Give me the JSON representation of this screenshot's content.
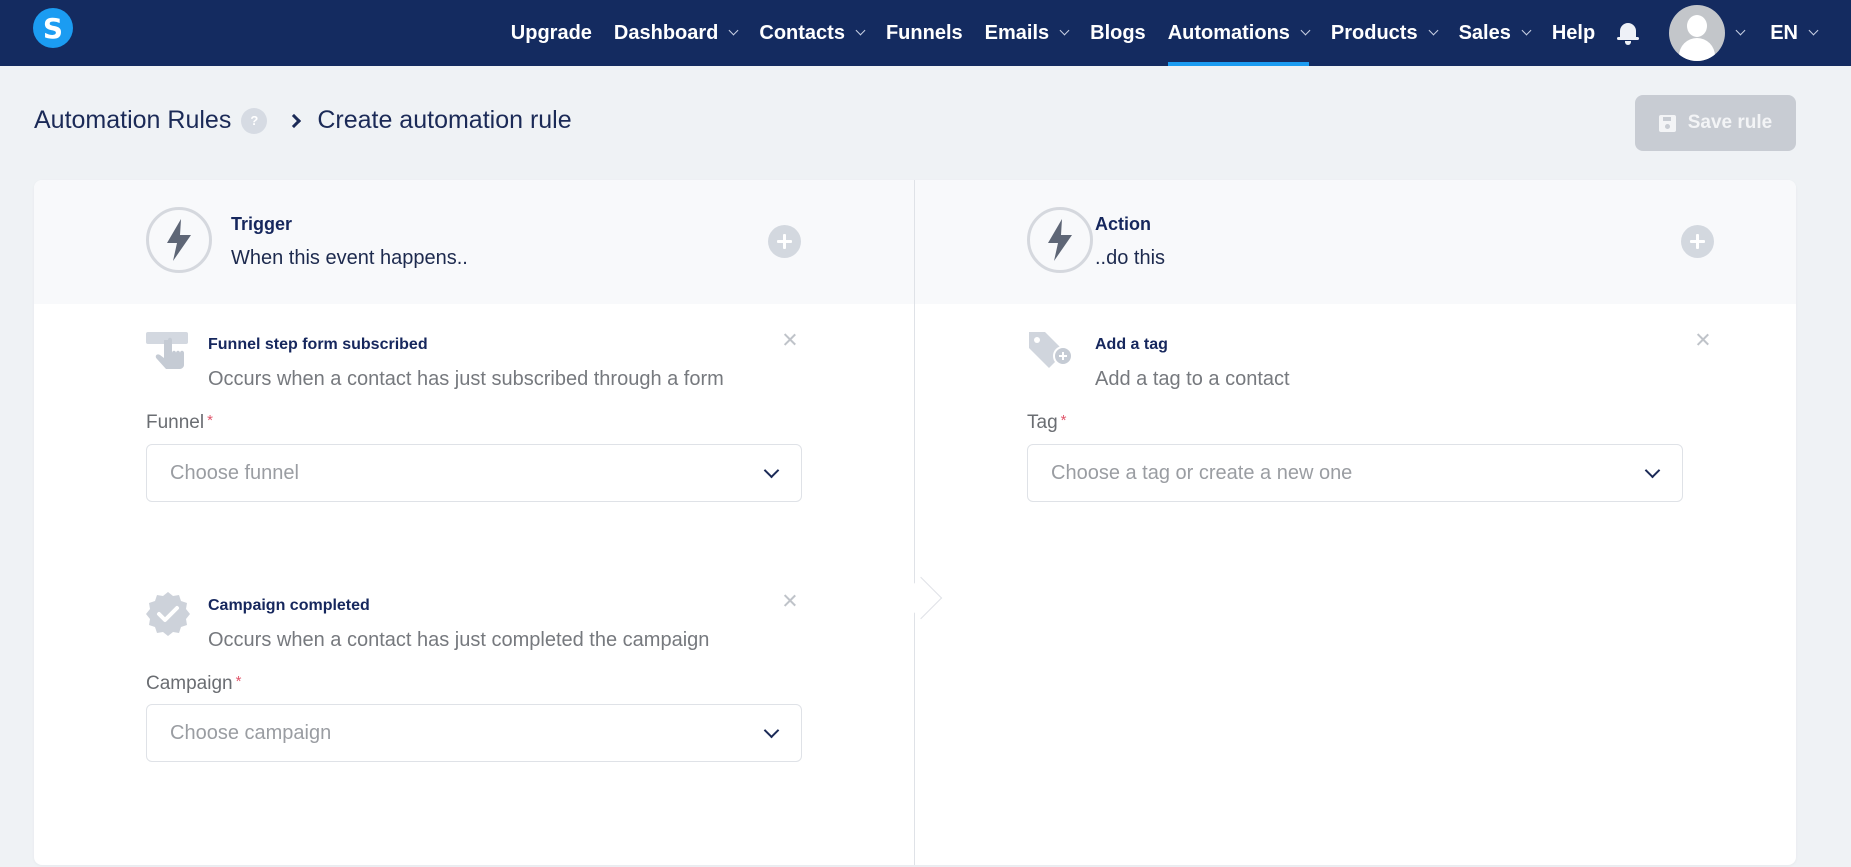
{
  "nav": {
    "logo_letter": "S",
    "items": [
      {
        "label": "Upgrade",
        "dropdown": false
      },
      {
        "label": "Dashboard",
        "dropdown": true
      },
      {
        "label": "Contacts",
        "dropdown": true
      },
      {
        "label": "Funnels",
        "dropdown": false
      },
      {
        "label": "Emails",
        "dropdown": true
      },
      {
        "label": "Blogs",
        "dropdown": false
      },
      {
        "label": "Automations",
        "dropdown": true,
        "active": true
      },
      {
        "label": "Products",
        "dropdown": true
      },
      {
        "label": "Sales",
        "dropdown": true
      },
      {
        "label": "Help",
        "dropdown": false
      }
    ],
    "language": "EN",
    "active_color": "#1b9cf2",
    "background": "#142b60"
  },
  "header": {
    "breadcrumb_parent": "Automation Rules",
    "help_badge": "?",
    "breadcrumb_current": "Create automation rule",
    "save_button": "Save rule"
  },
  "trigger": {
    "title": "Trigger",
    "subtitle": "When this event happens..",
    "items": [
      {
        "icon": "pointer-click-icon",
        "title": "Funnel step form subscribed",
        "description": "Occurs when a contact has just subscribed through a form",
        "field_label": "Funnel",
        "required": "*",
        "placeholder": "Choose funnel"
      },
      {
        "icon": "badge-check-icon",
        "title": "Campaign completed",
        "description": "Occurs when a contact has just completed the campaign",
        "field_label": "Campaign",
        "required": "*",
        "placeholder": "Choose campaign"
      }
    ]
  },
  "action": {
    "title": "Action",
    "subtitle": "..do this",
    "items": [
      {
        "icon": "tag-plus-icon",
        "title": "Add a tag",
        "description": "Add a tag to a contact",
        "field_label": "Tag",
        "required": "*",
        "placeholder": "Choose a tag or create a new one"
      }
    ]
  }
}
